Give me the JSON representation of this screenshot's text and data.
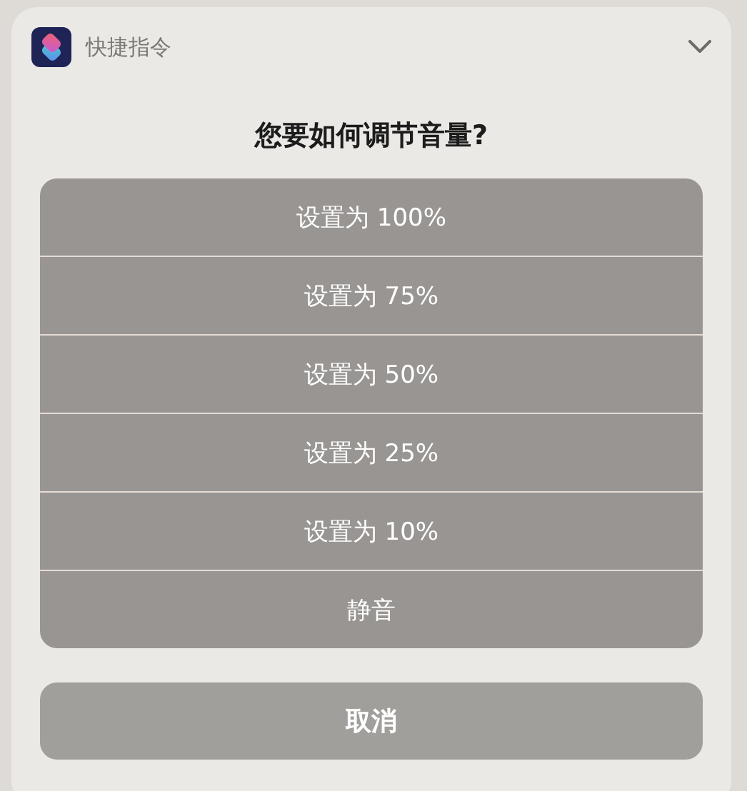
{
  "header": {
    "app_name": "快捷指令"
  },
  "question": "您要如何调节音量?",
  "options": [
    {
      "label": "设置为 100%"
    },
    {
      "label": "设置为 75%"
    },
    {
      "label": "设置为 50%"
    },
    {
      "label": "设置为 25%"
    },
    {
      "label": "设置为 10%"
    },
    {
      "label": "静音"
    }
  ],
  "cancel_button": "取消"
}
